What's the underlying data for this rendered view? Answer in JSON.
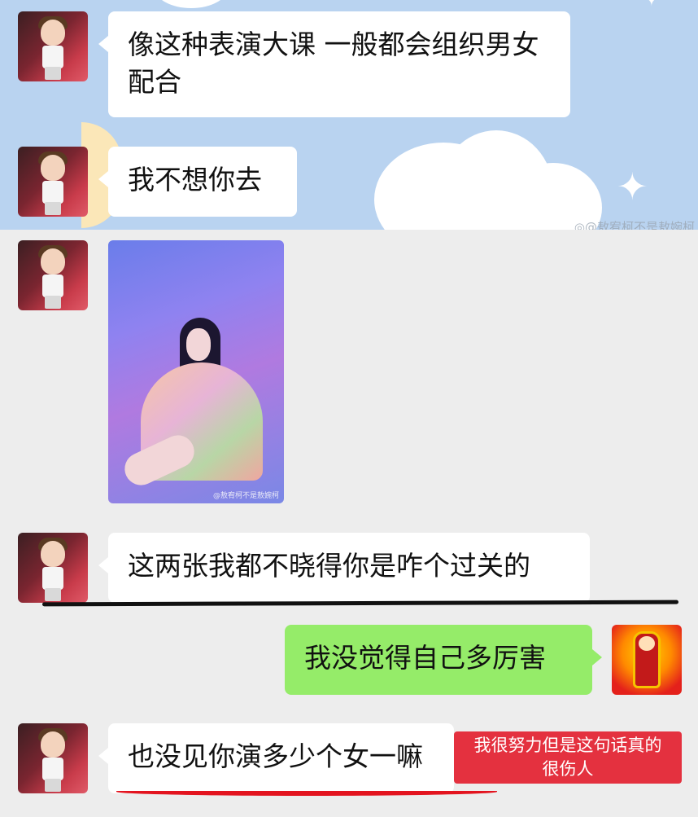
{
  "chat": {
    "messages": [
      {
        "sender": "contact",
        "type": "text",
        "text": "像这种表演大课 一般都会组织男女配合"
      },
      {
        "sender": "contact",
        "type": "text",
        "text": "我不想你去"
      },
      {
        "sender": "contact",
        "type": "image",
        "image_desc": "woman-in-floral-robe-photo",
        "watermark": "@敖宥柯不是敖婉柯"
      },
      {
        "sender": "contact",
        "type": "text",
        "text": "这两张我都不晓得你是咋个过关的"
      },
      {
        "sender": "me",
        "type": "text",
        "text": "我没觉得自己多厉害"
      },
      {
        "sender": "contact",
        "type": "text",
        "text": "也没见你演多少个女一嘛"
      }
    ]
  },
  "watermark": {
    "text": "◎@敖宥柯不是敖婉柯"
  },
  "annotation": {
    "text_line1": "我很努力但是这句话真的",
    "text_line2": "很伤人",
    "color": "#e4313f"
  },
  "colors": {
    "incoming_bubble": "#ffffff",
    "outgoing_bubble": "#95ec69",
    "background": "#ededed",
    "sky": "#b9d3f0",
    "underline_red": "#e3141f",
    "underline_black": "#111111"
  },
  "icons": [
    "contact-avatar",
    "my-avatar",
    "star-icon",
    "cloud-decoration",
    "moon-decoration"
  ]
}
